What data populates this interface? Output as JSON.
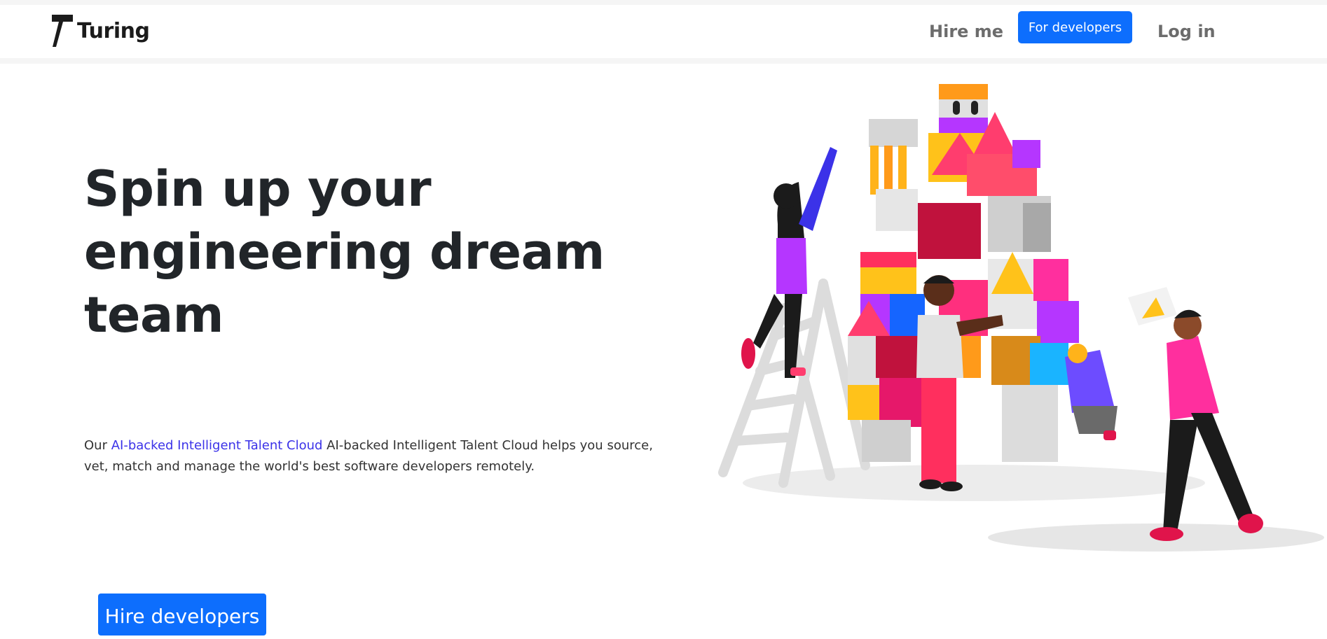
{
  "navbar": {
    "brand": "Turing",
    "links": {
      "hire_me": "Hire me",
      "for_developers": "For developers",
      "log_in": "Log in"
    }
  },
  "hero": {
    "title": "Spin up your engineering dream team",
    "description": {
      "prefix": "Our ",
      "link": "AI-backed Intelligent Talent Cloud",
      "suffix": " AI-backed Intelligent Talent Cloud helps you source, vet, match and manage the world's best software developers remotely."
    },
    "cta": "Hire developers"
  },
  "colors": {
    "primary": "#0d6efd",
    "link": "#3b32e8",
    "heading": "#212529"
  },
  "icons": {
    "brand_logo": "turing-logo-icon",
    "hero_image": "team-building-blocks-illustration"
  }
}
